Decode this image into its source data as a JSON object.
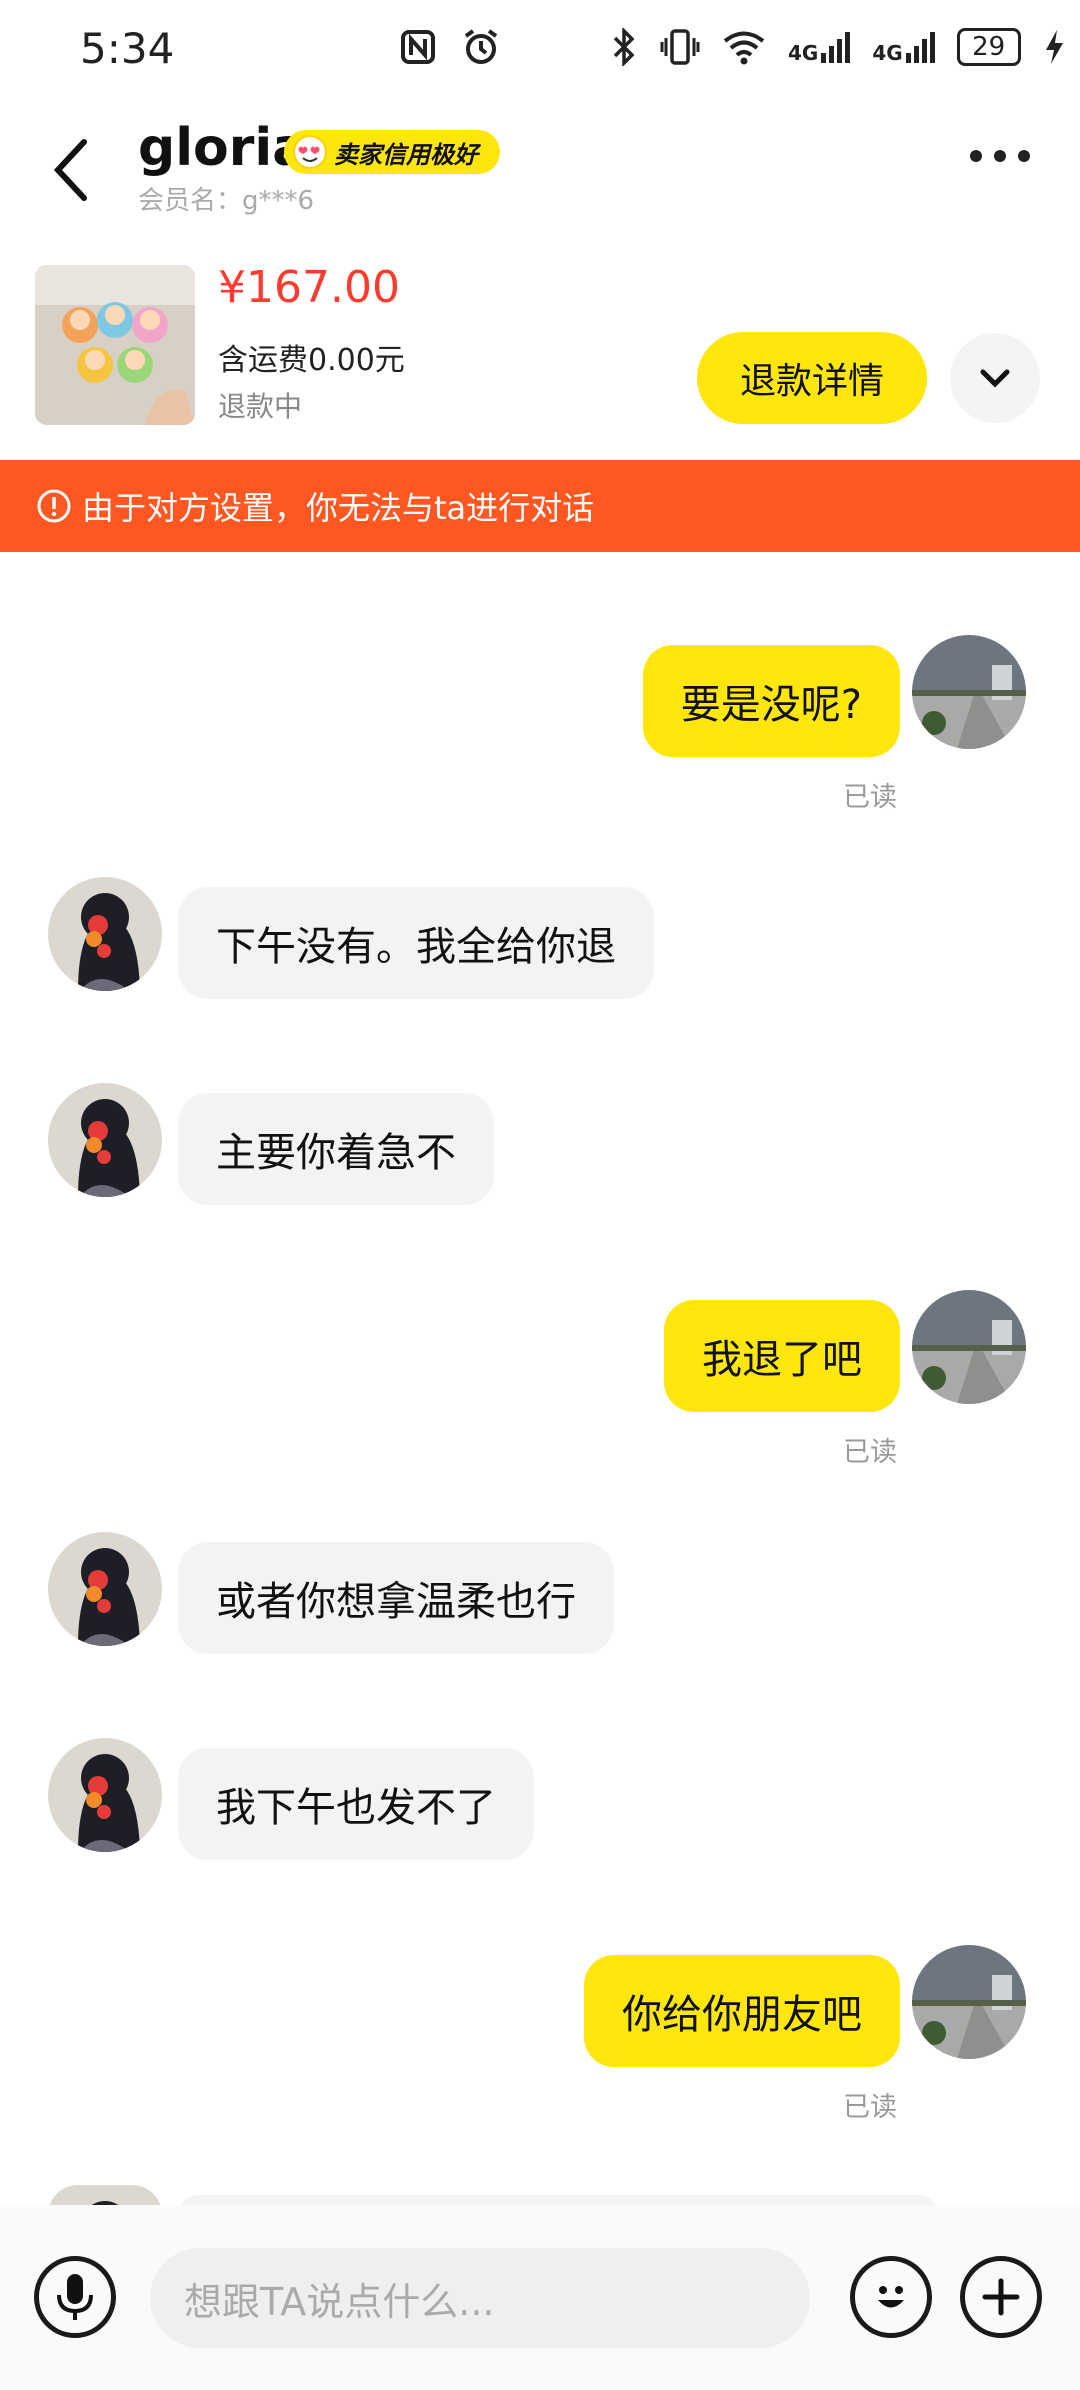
{
  "status_bar": {
    "time": "5:34",
    "battery": "29",
    "network1": "4G",
    "network2": "4G"
  },
  "header": {
    "name": "gloria",
    "badge": "卖家信用极好",
    "member": "会员名：g***6"
  },
  "product": {
    "price": "¥167.00",
    "shipping": "含运费0.00元",
    "state": "退款中",
    "refund_button": "退款详情"
  },
  "banner": {
    "text": "由于对方设置，你无法与ta进行对话"
  },
  "messages": [
    {
      "side": "out",
      "text": "要是没呢?",
      "read": "已读"
    },
    {
      "side": "in",
      "text": "下午没有。我全给你退"
    },
    {
      "side": "in",
      "text": "主要你着急不"
    },
    {
      "side": "out",
      "text": "我退了吧",
      "read": "已读"
    },
    {
      "side": "in",
      "text": "或者你想拿温柔也行"
    },
    {
      "side": "in",
      "text": "我下午也发不了"
    },
    {
      "side": "out",
      "text": "你给你朋友吧",
      "read": "已读"
    }
  ],
  "input": {
    "placeholder": "想跟TA说点什么..."
  },
  "colors": {
    "accent": "#ffe60f",
    "banner": "#ff5722",
    "price": "#ff3b30"
  },
  "icons": [
    "nfc-icon",
    "alarm-icon",
    "bluetooth-icon",
    "vibrate-icon",
    "wifi-icon",
    "signal-icon",
    "charging-icon",
    "back-icon",
    "more-icon",
    "chevron-down-icon",
    "alert-circle-icon",
    "microphone-icon",
    "emoji-icon",
    "plus-icon"
  ]
}
